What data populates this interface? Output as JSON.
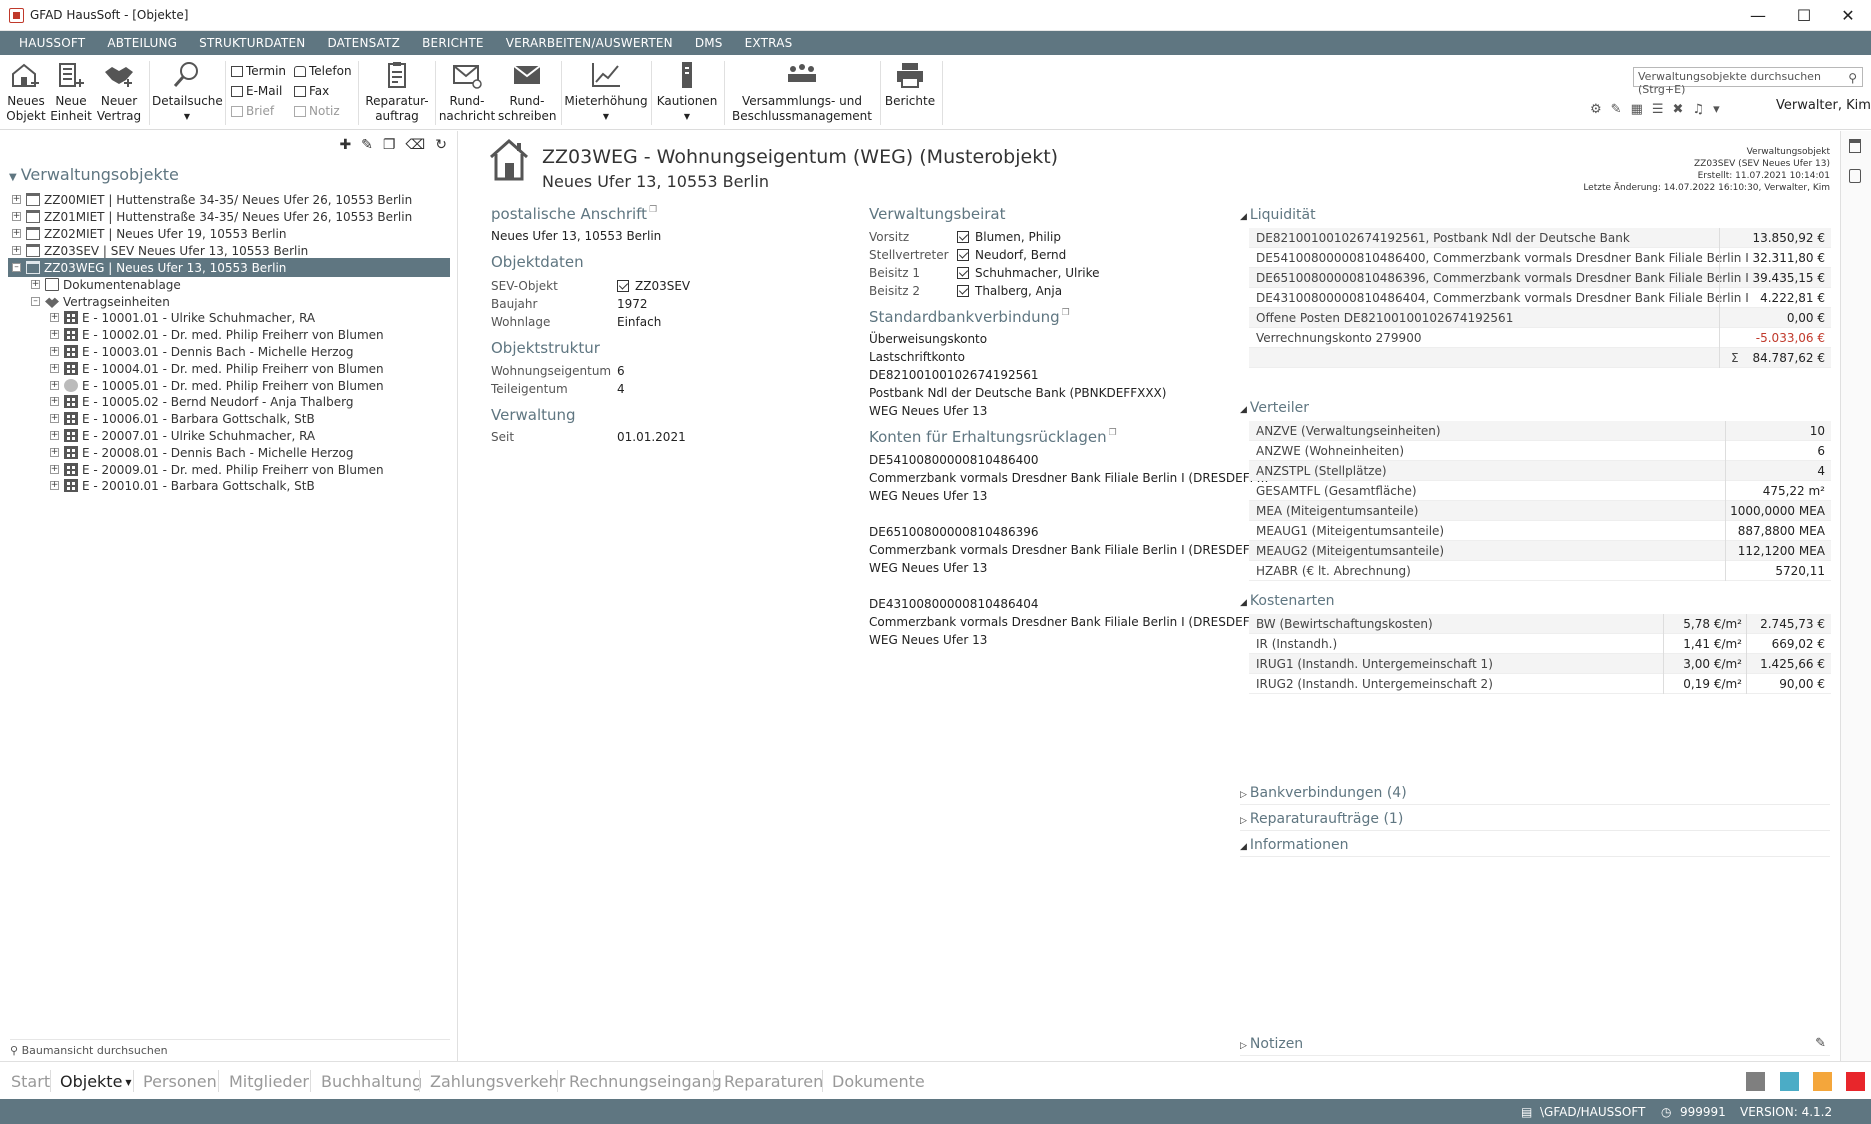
{
  "window": {
    "title": "GFAD HausSoft - [Objekte]"
  },
  "menu": [
    "HAUSSOFT",
    "ABTEILUNG",
    "STRUKTURDATEN",
    "DATENSATZ",
    "BERICHTE",
    "VERARBEITEN/AUSWERTEN",
    "DMS",
    "EXTRAS"
  ],
  "ribbon": {
    "neues_objekt": "Neues\nObjekt",
    "neue_einheit": "Neue\nEinheit",
    "neuer_vertrag": "Neuer\nVertrag",
    "detailsuche": "Detailsuche",
    "termin": "Termin",
    "telefon": "Telefon",
    "email": "E-Mail",
    "fax": "Fax",
    "brief": "Brief",
    "notiz": "Notiz",
    "reparaturauftrag": "Reparatur-\nauftrag",
    "rundnachricht": "Rund-\nnachricht",
    "rundschreiben": "Rund-\nschreiben",
    "mieterhoehung": "Mieterhöhung",
    "kautionen": "Kautionen",
    "versammlungs": "Versammlungs- und\nBeschlussmanagement",
    "berichte": "Berichte"
  },
  "search": {
    "placeholder": "Verwaltungsobjekte durchsuchen (Strg+E)"
  },
  "user": "Verwalter, Kim",
  "tree": {
    "title": "Verwaltungsobjekte",
    "items": [
      "ZZ00MIET | Huttenstraße 34-35/ Neues Ufer 26, 10553 Berlin",
      "ZZ01MIET | Huttenstraße 34-35/ Neues Ufer 26, 10553 Berlin",
      "ZZ02MIET | Neues Ufer 19, 10553 Berlin",
      "ZZ03SEV | SEV Neues Ufer 13, 10553 Berlin",
      "ZZ03WEG | Neues Ufer 13, 10553 Berlin"
    ],
    "dokumentenablage": "Dokumentenablage",
    "vertragseinheiten": "Vertragseinheiten",
    "units": [
      "E - 10001.01 - Ulrike Schuhmacher, RA",
      "E - 10002.01 - Dr. med. Philip Freiherr von Blumen",
      "E - 10003.01 - Dennis Bach - Michelle Herzog",
      "E - 10004.01 - Dr. med. Philip Freiherr von Blumen",
      "E - 10005.01 - Dr. med. Philip Freiherr von Blumen",
      "E - 10005.02 - Bernd Neudorf - Anja Thalberg",
      "E - 10006.01 - Barbara Gottschalk, StB",
      "E - 20007.01 - Ulrike Schuhmacher, RA",
      "E - 20008.01 - Dennis Bach - Michelle Herzog",
      "E - 20009.01 - Dr. med. Philip Freiherr von Blumen",
      "E - 20010.01 - Barbara Gottschalk, StB"
    ],
    "search_placeholder": "Baumansicht durchsuchen"
  },
  "object": {
    "title": "ZZ03WEG - Wohnungseigentum (WEG) (Musterobjekt)",
    "subtitle": "Neues Ufer 13, 10553 Berlin",
    "meta": {
      "line1": "Verwaltungsobjekt",
      "line2": "ZZ03SEV (SEV Neues Ufer 13)",
      "line3": "Erstellt: 11.07.2021 10:14:01",
      "line4": "Letzte Änderung: 14.07.2022 16:10:30, Verwalter, Kim"
    }
  },
  "col1": {
    "postal_h": "postalische Anschrift",
    "postal_v": "Neues Ufer 13, 10553 Berlin",
    "objektdaten_h": "Objektdaten",
    "sev_l": "SEV-Objekt",
    "sev_v": "ZZ03SEV",
    "baujahr_l": "Baujahr",
    "baujahr_v": "1972",
    "wohnlage_l": "Wohnlage",
    "wohnlage_v": "Einfach",
    "struktur_h": "Objektstruktur",
    "we_l": "Wohnungseigentum",
    "we_v": "6",
    "te_l": "Teileigentum",
    "te_v": "4",
    "verwaltung_h": "Verwaltung",
    "seit_l": "Seit",
    "seit_v": "01.01.2021"
  },
  "col2": {
    "beirat_h": "Verwaltungsbeirat",
    "vorsitz_l": "Vorsitz",
    "vorsitz_v": "Blumen, Philip",
    "stell_l": "Stellvertreter",
    "stell_v": "Neudorf, Bernd",
    "b1_l": "Beisitz 1",
    "b1_v": "Schuhmacher, Ulrike",
    "b2_l": "Beisitz 2",
    "b2_v": "Thalberg, Anja",
    "bank_h": "Standardbankverbindung",
    "bank_lines": [
      "Überweisungskonto",
      "Lastschriftkonto",
      "DE82100100102674192561",
      "Postbank Ndl der Deutsche Bank (PBNKDEFFXXX)",
      "WEG Neues Ufer 13"
    ],
    "ruecklagen_h": "Konten für Erhaltungsrücklagen",
    "ruecklagen": [
      [
        "DE54100800000810486400",
        "Commerzbank vormals Dresdner Bank Filiale Berlin I (DRESDEFF…",
        "WEG Neues Ufer 13"
      ],
      [
        "DE65100800000810486396",
        "Commerzbank vormals Dresdner Bank Filiale Berlin I (DRESDEFF…",
        "WEG Neues Ufer 13"
      ],
      [
        "DE43100800000810486404",
        "Commerzbank vormals Dresdner Bank Filiale Berlin I (DRESDEFF…",
        "WEG Neues Ufer 13"
      ]
    ]
  },
  "liquiditaet": {
    "title": "Liquidität",
    "rows": [
      [
        "DE82100100102674192561, Postbank Ndl der Deutsche Bank",
        "13.850,92 €"
      ],
      [
        "DE54100800000810486400, Commerzbank vormals Dresdner Bank Filiale Berlin I",
        "32.311,80 €"
      ],
      [
        "DE65100800000810486396, Commerzbank vormals Dresdner Bank Filiale Berlin I",
        "39.435,15 €"
      ],
      [
        "DE43100800000810486404, Commerzbank vormals Dresdner Bank Filiale Berlin I",
        "4.222,81 €"
      ],
      [
        "Offene Posten DE82100100102674192561",
        "0,00 €"
      ],
      [
        "Verrechnungskonto 279900",
        "-5.033,06 €"
      ]
    ],
    "sum_symbol": "Σ",
    "sum": "84.787,62 €"
  },
  "verteiler": {
    "title": "Verteiler",
    "rows": [
      [
        "ANZVE (Verwaltungseinheiten)",
        "10"
      ],
      [
        "ANZWE (Wohneinheiten)",
        "6"
      ],
      [
        "ANZSTPL (Stellplätze)",
        "4"
      ],
      [
        "GESAMTFL (Gesamtfläche)",
        "475,22 m²"
      ],
      [
        "MEA (Miteigentumsanteile)",
        "1000,0000 MEA"
      ],
      [
        "MEAUG1 (Miteigentumsanteile)",
        "887,8800 MEA"
      ],
      [
        "MEAUG2 (Miteigentumsanteile)",
        "112,1200 MEA"
      ],
      [
        "HZABR (€ lt. Abrechnung)",
        "5720,11"
      ]
    ]
  },
  "kostenarten": {
    "title": "Kostenarten",
    "rows": [
      [
        "BW (Bewirtschaftungskosten)",
        "5,78 €/m²",
        "2.745,73 €"
      ],
      [
        "IR (Instandh.)",
        "1,41 €/m²",
        "669,02 €"
      ],
      [
        "IRUG1 (Instandh. Untergemeinschaft 1)",
        "3,00 €/m²",
        "1.425,66 €"
      ],
      [
        "IRUG2 (Instandh. Untergemeinschaft 2)",
        "0,19 €/m²",
        "90,00 €"
      ]
    ]
  },
  "collapsed": {
    "bank": "Bankverbindungen (4)",
    "rep": "Reparaturaufträge (1)",
    "info": "Informationen",
    "notizen": "Notizen"
  },
  "nav": [
    "Start",
    "Objekte",
    "Personen",
    "Mitglieder",
    "Buchhaltung",
    "Zahlungsverkehr",
    "Rechnungseingang",
    "Reparaturen",
    "Dokumente"
  ],
  "nav_colors": [
    "#7f7f7f",
    "#4bacc6",
    "#f4a63b",
    "#e8262b"
  ],
  "status": {
    "path": "\\GFAD/HAUSSOFT",
    "code": "999991",
    "version": "VERSION: 4.1.2"
  }
}
